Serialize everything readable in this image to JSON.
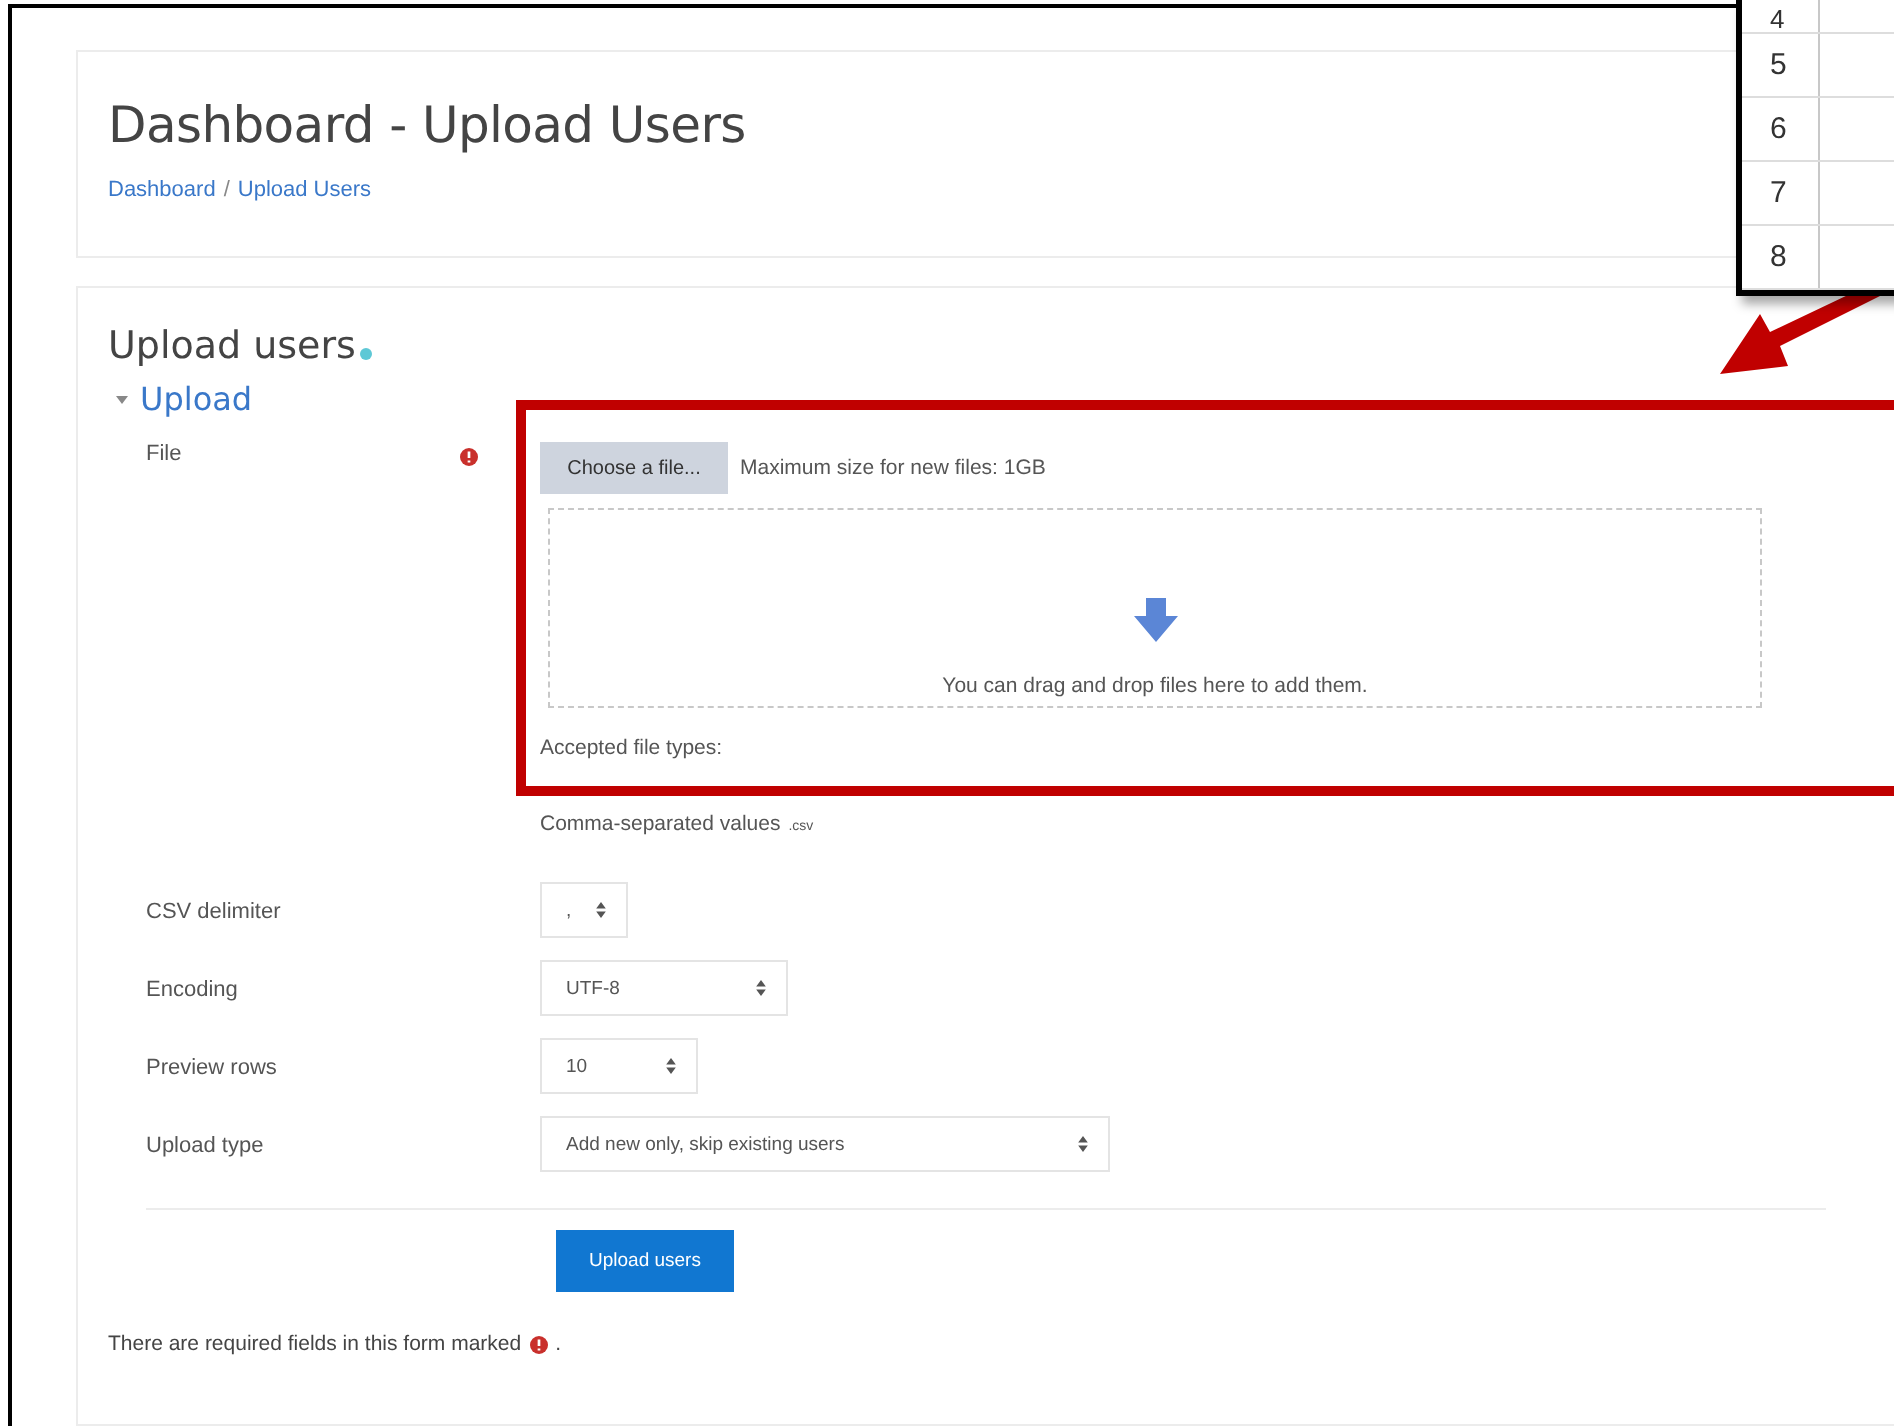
{
  "header": {
    "title": "Dashboard - Upload Users",
    "breadcrumb": [
      "Dashboard",
      "Upload Users"
    ],
    "separator": "/"
  },
  "form": {
    "heading": "Upload users",
    "section": {
      "title": "Upload",
      "expanded": true
    },
    "file": {
      "label": "File",
      "required": true,
      "button": "Choose a file...",
      "max_size": "Maximum size for new files: 1GB",
      "drop_hint": "You can drag and drop files here to add them.",
      "accepted_label": "Accepted file types:",
      "accepted_type": "Comma-separated values",
      "accepted_ext": ".csv"
    },
    "fields": [
      {
        "label": "CSV delimiter",
        "value": ","
      },
      {
        "label": "Encoding",
        "value": "UTF-8"
      },
      {
        "label": "Preview rows",
        "value": "10"
      },
      {
        "label": "Upload type",
        "value": "Add new only, skip existing users"
      }
    ],
    "submit": "Upload users",
    "required_note": "There are required fields in this form marked",
    "required_note_end": "."
  },
  "spreadsheet_inset": {
    "rows": [
      "4",
      "5",
      "6",
      "7",
      "8"
    ]
  }
}
